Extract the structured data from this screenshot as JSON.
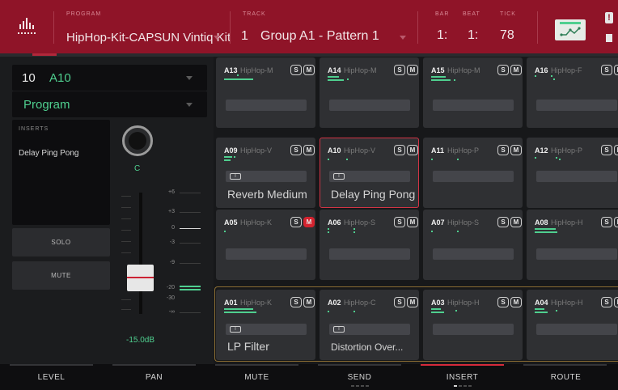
{
  "header": {
    "program_caption": "PROGRAM",
    "program_name": "HipHop-Kit-CAPSUN Vintiq Kit",
    "track_caption": "TRACK",
    "track_number": "1",
    "track_name": "Group A1 - Pattern 1",
    "bar_caption": "BAR",
    "beat_caption": "BEAT",
    "tick_caption": "TICK",
    "bar_value": "1:",
    "beat_value": "1:",
    "tick_value": "78",
    "warning_icon": "!"
  },
  "left_panel": {
    "pad_number": "10",
    "pad_name": "A10",
    "program_mode": "Program",
    "inserts_caption": "INSERTS",
    "insert_item": "Delay Ping Pong",
    "solo_label": "SOLO",
    "mute_label": "MUTE",
    "pan_value": "C",
    "fader_value": "-15.0dB",
    "scale": [
      "+6",
      "+3",
      "0",
      "-3",
      "-9",
      "-20",
      "-30",
      "-∞"
    ]
  },
  "pads": [
    {
      "id": "A13",
      "name": "HipHop-M",
      "insert": ""
    },
    {
      "id": "A14",
      "name": "HipHop-M",
      "insert": ""
    },
    {
      "id": "A15",
      "name": "HipHop-M",
      "insert": ""
    },
    {
      "id": "A16",
      "name": "HipHop-F",
      "insert": ""
    },
    {
      "id": "A09",
      "name": "HipHop-V",
      "insert": "Reverb Medium"
    },
    {
      "id": "A10",
      "name": "HipHop-V",
      "insert": "Delay Ping Pong"
    },
    {
      "id": "A11",
      "name": "HipHop-P",
      "insert": ""
    },
    {
      "id": "A12",
      "name": "HipHop-P",
      "insert": ""
    },
    {
      "id": "A05",
      "name": "HipHop-K",
      "insert": ""
    },
    {
      "id": "A06",
      "name": "HipHop-S",
      "insert": ""
    },
    {
      "id": "A07",
      "name": "HipHop-S",
      "insert": ""
    },
    {
      "id": "A08",
      "name": "HipHop-H",
      "insert": ""
    },
    {
      "id": "A01",
      "name": "HipHop-K",
      "insert": "LP Filter"
    },
    {
      "id": "A02",
      "name": "HipHop-C",
      "insert": "Distortion Over..."
    },
    {
      "id": "A03",
      "name": "HipHop-H",
      "insert": ""
    },
    {
      "id": "A04",
      "name": "HipHop-H",
      "insert": ""
    }
  ],
  "pad_buttons": {
    "solo": "S",
    "mute": "M",
    "insert_icon": "I"
  },
  "pad_state": {
    "selected_pad": "A10",
    "muted_pads": [
      "A05"
    ]
  },
  "bottom_tabs": [
    "LEVEL",
    "PAN",
    "MUTE",
    "SEND",
    "INSERT",
    "ROUTE"
  ],
  "active_tab": "INSERT",
  "colors": {
    "header": "#8f1428",
    "accent_green": "#4fcf8f",
    "accent_red": "#d62a3a",
    "group_outline": "#8a6d33"
  }
}
